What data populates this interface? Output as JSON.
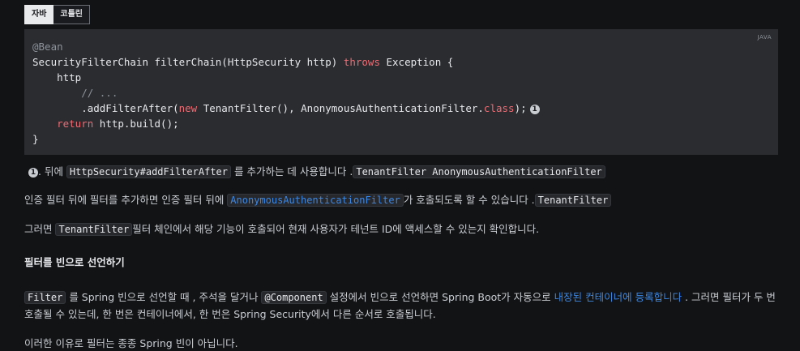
{
  "tabs": {
    "java_label": "자바",
    "kotlin_label": "코틀린"
  },
  "code_block": {
    "language": "JAVA",
    "lines": [
      "@Bean",
      "SecurityFilterChain filterChain(HttpSecurity http) throws Exception {",
      "    http",
      "        // ...",
      "        .addFilterAfter(new TenantFilter(), AnonymousAuthenticationFilter.class);",
      "    return http.build();",
      "}"
    ],
    "callout_number": "1"
  },
  "note": {
    "number": "1",
    "text_before": ". 뒤에 ",
    "code1": "HttpSecurity#addFilterAfter",
    "text_mid": " 를 추가하는 데 사용합니다 .",
    "code2": "TenantFilter AnonymousAuthenticationFilter"
  },
  "para1": {
    "text_before": "인증 필터 뒤에 필터를 추가하면 인증 필터 뒤에 ",
    "code1": "AnonymousAuthenticationFilter",
    "text_mid": "가 호출되도록 할 수 있습니다 .",
    "code2": "TenantFilter"
  },
  "para2": {
    "text_before": "그러면 ",
    "code1": "TenantFilter",
    "text_after": "필터 체인에서 해당 기능이 호출되어 현재 사용자가 테넌트 ID에 액세스할 수 있는지 확인합니다."
  },
  "heading": "필터를 빈으로 선언하기",
  "para3": {
    "code1": "Filter",
    "text1": " 를 Spring 빈으로 선언할 때 , 주석을 달거나 ",
    "code2": "@Component",
    "text2": " 설정에서 빈으로 선언하면 Spring Boot가 자동으로 ",
    "link": "내장된 컨테이너에 등록합니다",
    "text3": " . 그러면 필터가 두 번",
    "line2": "호출될 수 있는데, 한 번은 컨테이너에서, 한 번은 Spring Security에서 다른 순서로 호출됩니다."
  },
  "para4": "이러한 이유로 필터는 종종 Spring 빈이 아닙니다."
}
